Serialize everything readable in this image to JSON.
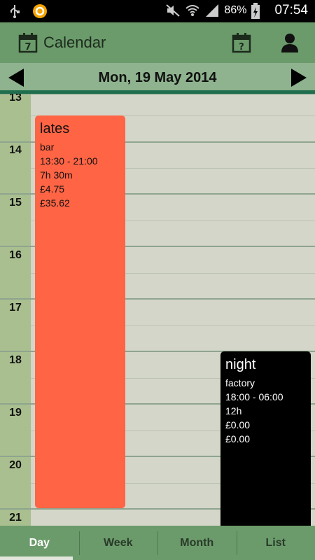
{
  "status_bar": {
    "battery_percent": "86%",
    "time": "07:54",
    "icons": [
      "usb-icon",
      "app-notification-icon",
      "mute-icon",
      "wifi-icon",
      "signal-icon",
      "battery-charging-icon"
    ]
  },
  "action_bar": {
    "title": "Calendar",
    "calendar_icon_day": "7",
    "today_icon_mark": "?",
    "icons": [
      "calendar-icon",
      "go-to-date-icon",
      "person-icon"
    ]
  },
  "date_nav": {
    "date": "Mon, 19 May 2014"
  },
  "hours": [
    "13",
    "14",
    "15",
    "16",
    "17",
    "18",
    "19",
    "20",
    "21"
  ],
  "events": [
    {
      "title": "lates",
      "place": "bar",
      "time": "13:30 - 21:00",
      "duration": "7h 30m",
      "rate": "£4.75",
      "total": "£35.62",
      "color": "#ff6444"
    },
    {
      "title": "night",
      "place": "factory",
      "time": "18:00 - 06:00",
      "duration": "12h",
      "rate": "£0.00",
      "total": "£0.00",
      "color": "#000000"
    }
  ],
  "tabs": [
    {
      "label": "Day",
      "active": true
    },
    {
      "label": "Week",
      "active": false
    },
    {
      "label": "Month",
      "active": false
    },
    {
      "label": "List",
      "active": false
    }
  ],
  "colors": {
    "action_bar": "#6b9b6b",
    "date_nav": "#8eb38e",
    "accent_line": "#1f6f4f"
  }
}
